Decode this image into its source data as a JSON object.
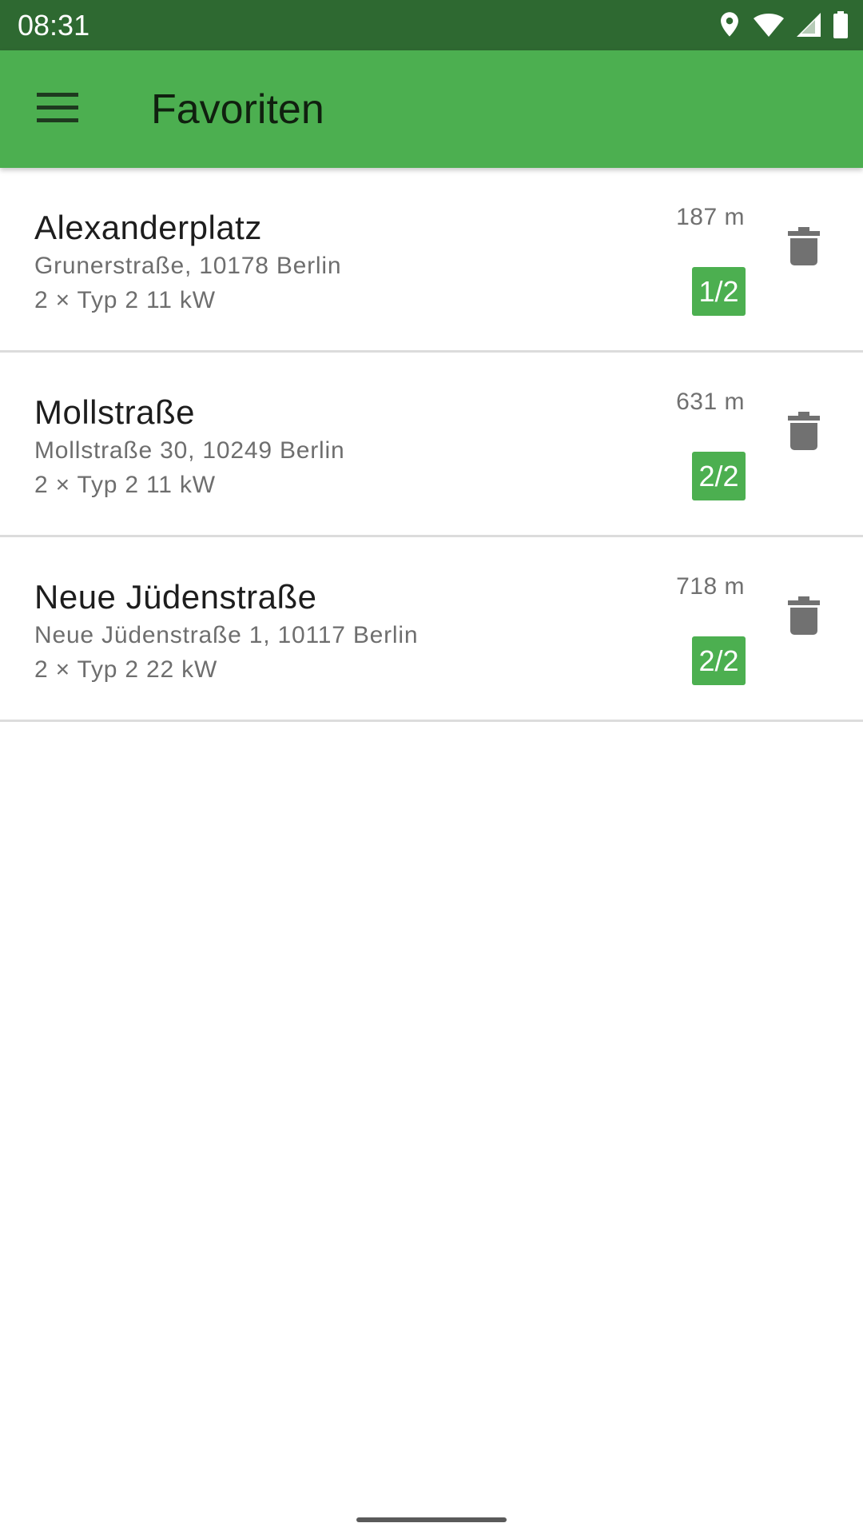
{
  "status_bar": {
    "time": "08:31",
    "icons": [
      "location-icon",
      "wifi-icon",
      "signal-icon",
      "battery-icon"
    ]
  },
  "app_bar": {
    "title": "Favoriten",
    "menu_icon": "menu-icon"
  },
  "favorites": [
    {
      "name": "Alexanderplatz",
      "address": "Grunerstraße, 10178 Berlin",
      "connectors": "2 × Typ 2 11 kW",
      "distance": "187 m",
      "availability": "1/2"
    },
    {
      "name": "Mollstraße",
      "address": "Mollstraße 30, 10249 Berlin",
      "connectors": "2 × Typ 2 11 kW",
      "distance": "631 m",
      "availability": "2/2"
    },
    {
      "name": "Neue Jüdenstraße",
      "address": "Neue Jüdenstraße 1, 10117 Berlin",
      "connectors": "2 × Typ 2 22 kW",
      "distance": "718 m",
      "availability": "2/2"
    }
  ],
  "colors": {
    "status_bar": "#2e6931",
    "app_bar": "#4caf50",
    "badge": "#4caf50",
    "delete_icon": "#717171"
  }
}
